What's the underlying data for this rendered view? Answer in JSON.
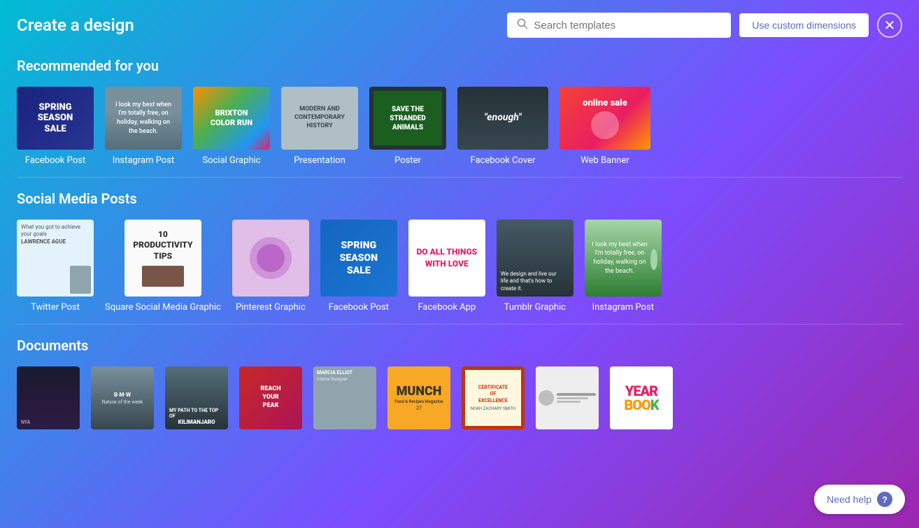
{
  "header": {
    "title": "Create a design",
    "search_placeholder": "Search templates",
    "custom_dimensions_label": "Use custom dimensions"
  },
  "sections": {
    "recommended": {
      "title": "Recommended for you",
      "items": [
        {
          "label": "Facebook Post",
          "thumb_type": "facebook-post"
        },
        {
          "label": "Instagram Post",
          "thumb_type": "instagram-post"
        },
        {
          "label": "Social Graphic",
          "thumb_type": "social-graphic"
        },
        {
          "label": "Presentation",
          "thumb_type": "presentation"
        },
        {
          "label": "Poster",
          "thumb_type": "poster"
        },
        {
          "label": "Facebook Cover",
          "thumb_type": "facebook-cover"
        },
        {
          "label": "Web Banner",
          "thumb_type": "web-banner"
        }
      ]
    },
    "social_media": {
      "title": "Social Media Posts",
      "items": [
        {
          "label": "Twitter Post",
          "thumb_type": "twitter-post"
        },
        {
          "label": "Square Social Media Graphic",
          "thumb_type": "square-social"
        },
        {
          "label": "Pinterest Graphic",
          "thumb_type": "pinterest-graphic"
        },
        {
          "label": "Facebook Post",
          "thumb_type": "facebook-post-2"
        },
        {
          "label": "Facebook App",
          "thumb_type": "facebook-app"
        },
        {
          "label": "Tumblr Graphic",
          "thumb_type": "tumblr-graphic"
        },
        {
          "label": "Instagram Post",
          "thumb_type": "instagram-post-2"
        }
      ]
    },
    "documents": {
      "title": "Documents",
      "items": [
        {
          "label": "",
          "thumb_type": "doc-dark"
        },
        {
          "label": "",
          "thumb_type": "doc-mountain"
        },
        {
          "label": "",
          "thumb_type": "doc-kili"
        },
        {
          "label": "",
          "thumb_type": "doc-peak"
        },
        {
          "label": "",
          "thumb_type": "doc-person"
        },
        {
          "label": "",
          "thumb_type": "doc-food"
        },
        {
          "label": "",
          "thumb_type": "doc-cert"
        },
        {
          "label": "",
          "thumb_type": "doc-person2"
        },
        {
          "label": "",
          "thumb_type": "doc-yearbook"
        }
      ]
    }
  },
  "help_button": {
    "label": "Need help"
  },
  "spring_sale_text": "spring season sale",
  "productivity_tips": "10 PRODUCTIVITY TIPS",
  "spring_season_sale2": "spring season sale",
  "do_all_things": "DO ALL THINGS WITH LOVE",
  "online_sale": "online sale",
  "brixton_color_run": "BRIXTON COLOR RUN",
  "modern_history": "MODERN AND CONTEMPORARY HISTORY",
  "save_animals": "SAVE THE STRANDED ANIMALS",
  "enough": "enough",
  "totally_free": "I look my best when I'm totally free, on holiday, walking on the beach.",
  "reach_peak": "REACH YOUR PEAK",
  "munch": "MUNCH",
  "certificate": "CERTIFICATE OF EXCELLENCE",
  "yearbook": "YEAR BOOK"
}
